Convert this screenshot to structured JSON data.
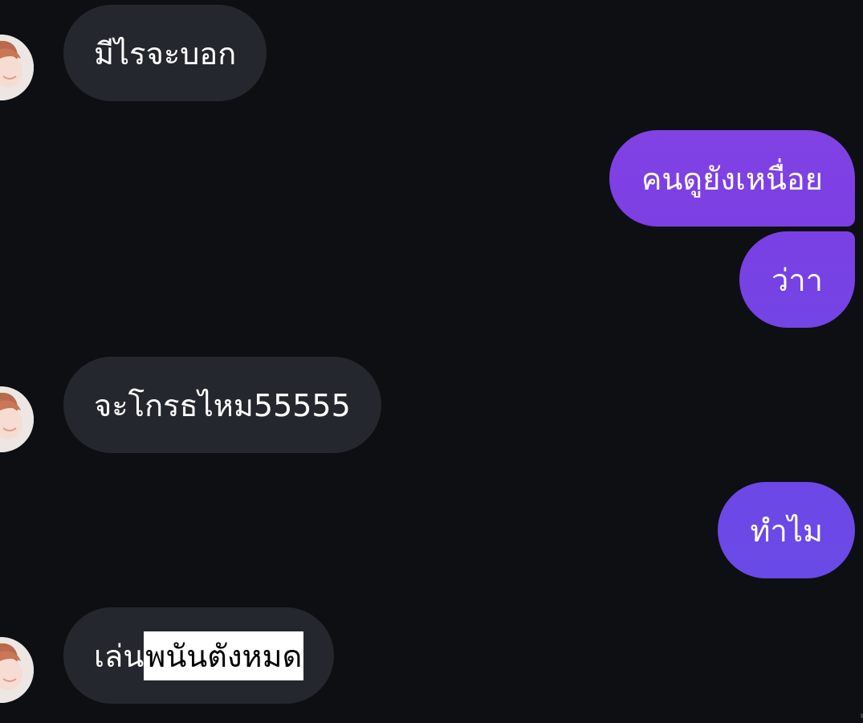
{
  "colors": {
    "background": "#0d0f13",
    "incoming_bubble": "#24272d",
    "outgoing_bubble_start": "#7a3fe4",
    "outgoing_bubble_end": "#6a4ae6",
    "text": "#ffffff",
    "highlight_bg": "#ffffff",
    "highlight_text": "#000000"
  },
  "messages": [
    {
      "side": "incoming",
      "text": "มีไรจะบอก",
      "avatar": "avatar-icon"
    },
    {
      "side": "outgoing",
      "text": "คนดูยังเหนื่อย"
    },
    {
      "side": "outgoing",
      "text": "ว่าา"
    },
    {
      "side": "incoming",
      "text": "จะโกรธไหม55555",
      "avatar": "avatar-icon"
    },
    {
      "side": "outgoing",
      "text": "ทำไม"
    },
    {
      "side": "incoming",
      "text_plain": "เล่น",
      "text_highlighted": "พนันตังหมด",
      "avatar": "avatar-icon"
    }
  ]
}
